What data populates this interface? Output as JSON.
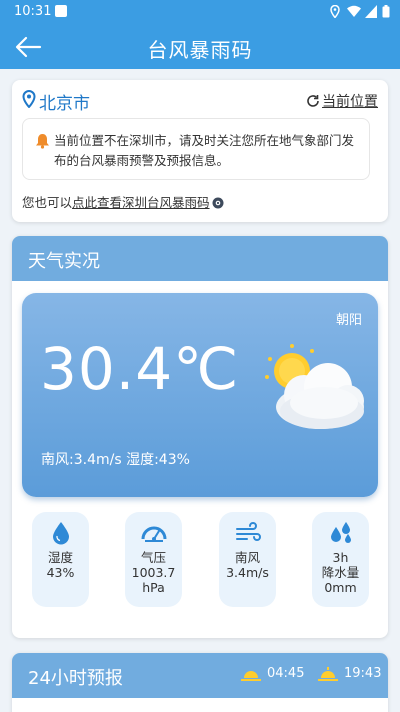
{
  "status": {
    "time": "10:31"
  },
  "header": {
    "title": "台风暴雨码"
  },
  "location": {
    "city": "北京市",
    "current_position": "当前位置",
    "notice": "当前位置不在深圳市，请及时关注您所在地气象部门发布的台风暴雨预警及预报信息。",
    "link_prefix": "您也可以",
    "link_text": "点此查看深圳台风暴雨码"
  },
  "weather": {
    "section_title": "天气实况",
    "district": "朝阳",
    "temperature": "30.4℃",
    "wind_humidity": "南风:3.4m/s 湿度:43%",
    "stats": [
      {
        "icon": "humidity-drop-icon",
        "label": "湿度",
        "value": "43%"
      },
      {
        "icon": "pressure-gauge-icon",
        "label": "气压",
        "value": "1003.7",
        "unit": "hPa"
      },
      {
        "icon": "wind-icon",
        "label": "南风",
        "value": "3.4m/s"
      },
      {
        "icon": "rain-drops-icon",
        "label": "3h",
        "value": "降水量",
        "unit": "0mm"
      }
    ]
  },
  "forecast": {
    "section_title": "24小时预报",
    "sunrise": "04:45",
    "sunset": "19:43"
  },
  "colors": {
    "primary": "#3b9de3",
    "section_header": "#71acdf",
    "accent_text": "#1f78c8"
  }
}
